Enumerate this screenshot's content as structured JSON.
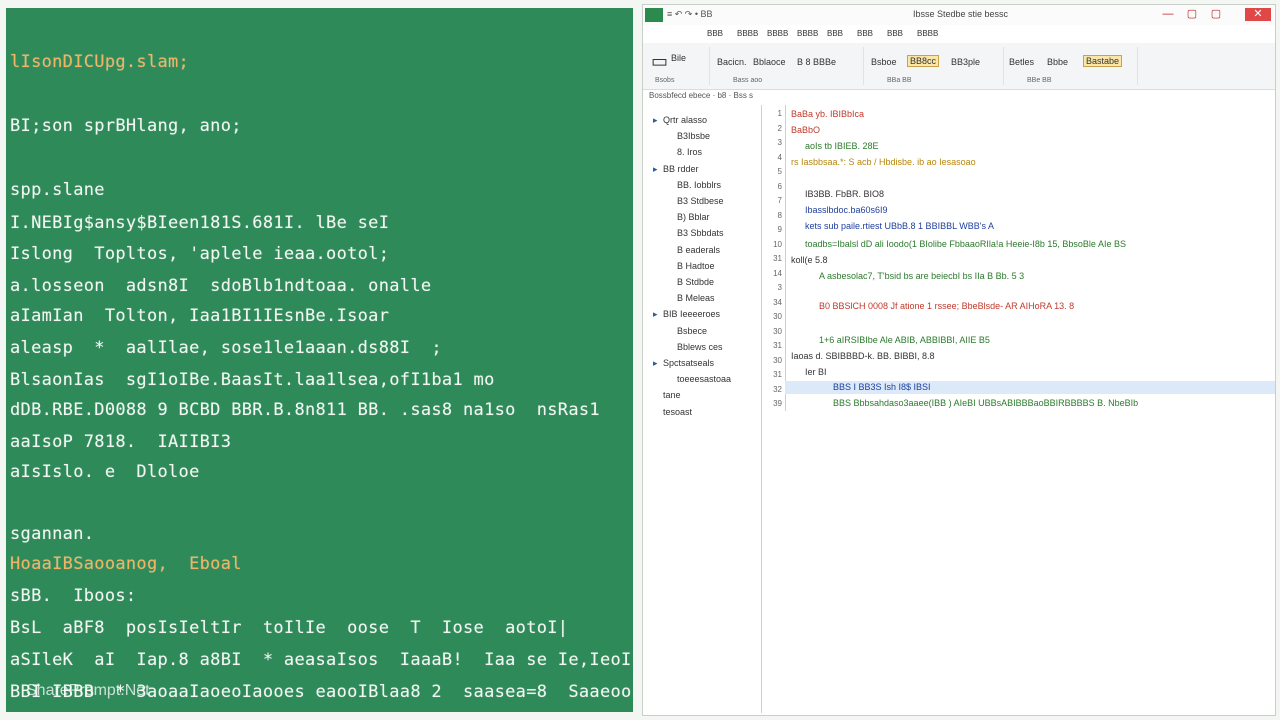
{
  "terminal": {
    "lines": [
      {
        "text": "lIsonDICUpg.slam;",
        "tone": "orange"
      },
      {
        "text": "BI;son sprBHlang, ano;",
        "tone": "white"
      },
      {
        "text": "spp.slane",
        "tone": "white"
      },
      {
        "text": "I.NEBIg$ansy$BIeen181S.681I. lBe seI",
        "tone": "white"
      },
      {
        "text": "Islong  Topltos, 'aplele ieaa.ootol;",
        "tone": "white"
      },
      {
        "text": "a.losseon  adsn8I  sdoBlb1ndtoaa. onalle",
        "tone": "white"
      },
      {
        "text": "aIamIan  Tolton, Iaa1BI1IEsnBe.Isoar",
        "tone": "white"
      },
      {
        "text": "aleasp  *  aalIlae, sose1le1aaan.ds88I  ;",
        "tone": "white"
      },
      {
        "text": "BlsaonIas  sgI1oIBe.BaasIt.laa1lsea,ofI1ba1 mo",
        "tone": "white"
      },
      {
        "text": "dDB.RBE.D0088 9 BCBD BBR.B.8n811 BB. .sas8 na1so  nsRas1",
        "tone": "mixed"
      },
      {
        "text": "aaIsoP 7818.  IAIIBI3",
        "tone": "white"
      },
      {
        "text": "aIsIslo. e  Dloloe",
        "tone": "white"
      },
      {
        "text": "sgannan.",
        "tone": "white"
      },
      {
        "text": "HoaaIBSaooanog,  Eboal",
        "tone": "orange"
      },
      {
        "text": "sBB.  Iboos:",
        "tone": "white"
      },
      {
        "text": "BsL  aBF8  posIsIeltIr  toIlIe  oose  T  Iose  aotoI|",
        "tone": "white"
      },
      {
        "text": "aSIleK  aI  Iap.8 a8BI  * aeasaIsos  IaaaB!  Iaa se Ie,IeoI",
        "tone": "mixed"
      },
      {
        "text": "BBI IBBB  * 3aoaaIaoeoIaooes eaooIBlaa8 2  saasea=8  Saaeoo",
        "tone": "mixed"
      }
    ],
    "watermark": "SharePrompt.Net"
  },
  "ide": {
    "quick_access": "≡ ↶ ↷ •   BB",
    "window_title": "Ibsse Stedbe  stie bessc",
    "win_controls": [
      "—",
      "▢",
      "▢",
      "✕"
    ],
    "ribbon_tabs": [
      "BBB",
      "BBBB",
      "BBBB",
      "BBBB",
      "BBB",
      "BBB",
      "BBB",
      "BBBB"
    ],
    "ribbon": {
      "g1_btn": "Bile",
      "g1_sub": "Bsobs",
      "g2_a": "Bacicn.",
      "g2_b": "Bblaoce",
      "g2_c": "B 8 BBBe",
      "g2_sub": "Bass  aoo",
      "g3_a": "Bsboe",
      "g3_b": "BB8cc",
      "g3_c": "BB3ple",
      "g3_sub": "BBa  BB",
      "g4_a": "Betles",
      "g4_b": "Bbbe",
      "g4_c": "Bastabe",
      "g4_sub": "BBe  BB"
    },
    "path": "Bossbfecd ebece · b8 · Bss s",
    "tree": [
      {
        "label": "Qrtr  alasso",
        "indent": 0,
        "tw": "▸"
      },
      {
        "label": "B3Ibsbe",
        "indent": 1,
        "tw": ""
      },
      {
        "label": "8. Iros",
        "indent": 1,
        "tw": ""
      },
      {
        "label": "BB  rdder",
        "indent": 0,
        "tw": "▸"
      },
      {
        "label": "BB. Iobblrs",
        "indent": 1,
        "tw": ""
      },
      {
        "label": "B3  Stdbese",
        "indent": 1,
        "tw": ""
      },
      {
        "label": "B) Bblar",
        "indent": 1,
        "tw": ""
      },
      {
        "label": "B3  Sbbdats",
        "indent": 1,
        "tw": ""
      },
      {
        "label": "B  eaderals",
        "indent": 1,
        "tw": ""
      },
      {
        "label": "B  Hadtoe",
        "indent": 1,
        "tw": ""
      },
      {
        "label": "B  Stdbde",
        "indent": 1,
        "tw": ""
      },
      {
        "label": "B  Meleas",
        "indent": 1,
        "tw": ""
      },
      {
        "label": "BIB  Ieeeeroes",
        "indent": 0,
        "tw": "▸"
      },
      {
        "label": "Bsbece",
        "indent": 1,
        "tw": ""
      },
      {
        "label": "Bblews ces",
        "indent": 1,
        "tw": ""
      },
      {
        "label": "Spctsatseals",
        "indent": 0,
        "tw": "▸"
      },
      {
        "label": "toeeesastoaa",
        "indent": 1,
        "tw": ""
      },
      {
        "label": "tane",
        "indent": 0,
        "tw": ""
      },
      {
        "label": "tesoast",
        "indent": 0,
        "tw": ""
      }
    ],
    "gutter": [
      "1",
      "2",
      "3",
      "4",
      "5",
      "6",
      "7",
      "8",
      "9",
      "10",
      "31",
      "14",
      "3",
      "34",
      "30",
      "30",
      "31",
      "30",
      "31",
      "32",
      "39"
    ],
    "code": [
      {
        "text": "BaBa yb.  IBIBbIca",
        "color": "red",
        "indent": 0
      },
      {
        "text": "BaBbO",
        "color": "red",
        "indent": 0
      },
      {
        "text": "aoIs tb IBIEB. 28E",
        "color": "green",
        "indent": 1
      },
      {
        "text": "  rs Iasbbsaa.*: S acb / Hbdisbe. ib ao Iesasoao",
        "color": "orange",
        "indent": 0
      },
      {
        "text": "IB3BB. FbBR. BIO8",
        "color": "dark",
        "indent": 1
      },
      {
        "text": "Ibasslbdoc.ba60s6I9",
        "color": "blue",
        "indent": 1
      },
      {
        "text": "kets sub paile.rtiest UBbB.8 1 BBIBBL WBB's A",
        "color": "blue",
        "indent": 1
      },
      {
        "text": "toadbs=Ibalsl dD ali Ioodo(1 BIolibe FbbaaoRIla!a Heeie-I8b 15, BbsoBle AIe BS",
        "color": "green",
        "indent": 1
      },
      {
        "text": "koll(e 5.8",
        "color": "dark",
        "indent": 0
      },
      {
        "text": "A asbesolac7, T'bsid bs  are beiecbI bs IIa  B Bb. 5 3",
        "color": "green",
        "indent": 2
      },
      {
        "text": "B0 BBSlCH 0008 Jf atione 1 rssee; BbeBlsde- AR AIHoRA 13. 8",
        "color": "red",
        "indent": 2
      },
      {
        "text": "1+6 aIRSIBIbe  Ale  ABIB, ABBIBBI, AIIE  B5",
        "color": "green",
        "indent": 2
      },
      {
        "text": "Iaoas d.  SBIBBBD-k. BB. BIBBI, 8.8",
        "color": "dark",
        "indent": 0
      },
      {
        "text": "Ier  BI",
        "color": "dark",
        "indent": 1
      },
      {
        "text": "BBS I BB3S Ish I8$ IBSI",
        "color": "blue",
        "indent": 3
      },
      {
        "text": "BBS Bbbsahdaso3aaee(IBB  ) AIeBI UBBsABIBBBaoBBIRBBBBS B. NbeBIb",
        "color": "green",
        "indent": 3
      }
    ]
  }
}
